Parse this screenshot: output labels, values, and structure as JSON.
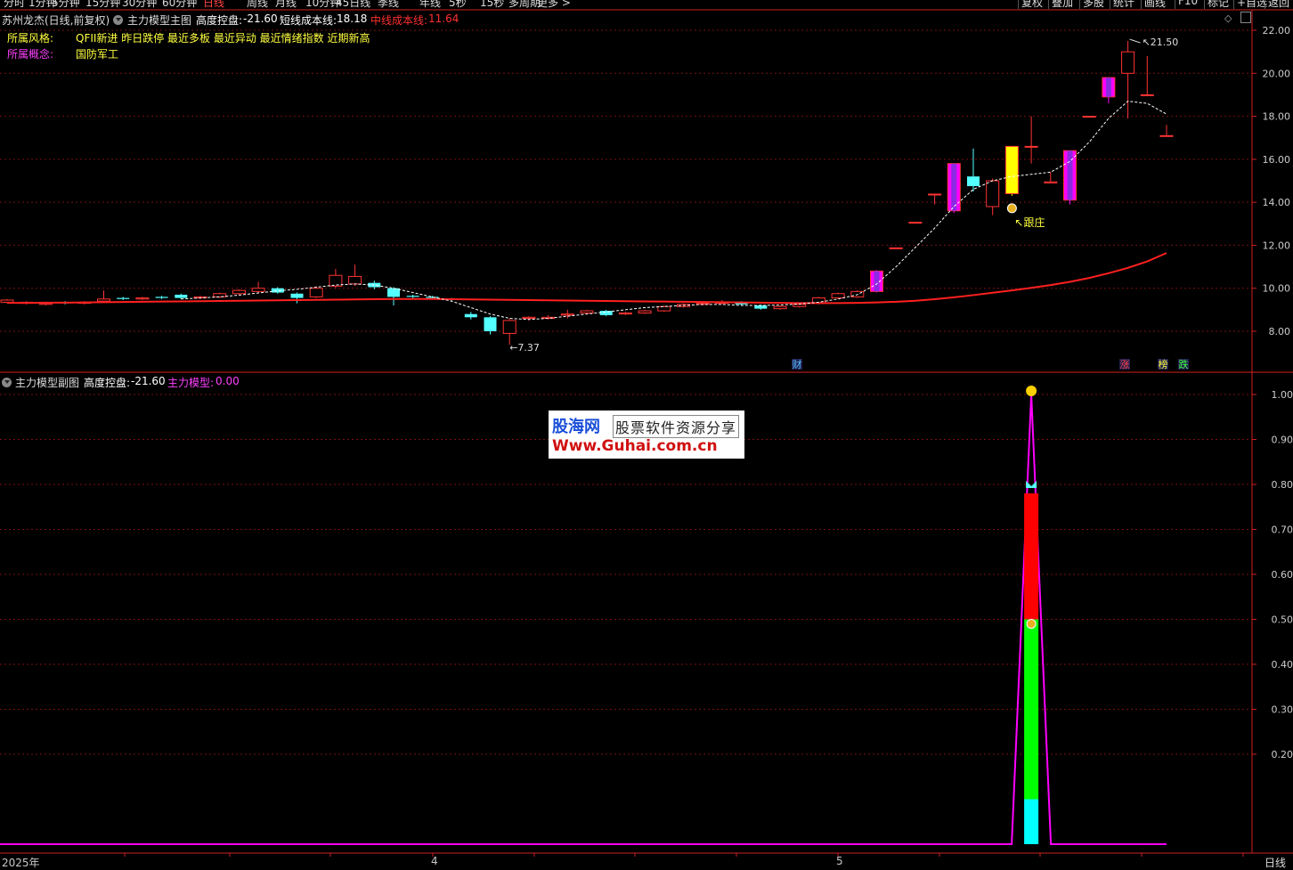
{
  "toolbar": {
    "periods": [
      "分时",
      "1分钟",
      "5分钟",
      "15分钟",
      "30分钟",
      "60分钟",
      "日线",
      "周线",
      "月线",
      "10分钟",
      "45日线",
      "季线",
      "年线",
      "5秒",
      "15秒",
      "多周期",
      "更多 >"
    ],
    "active_period": "日线",
    "right_buttons": [
      "复权",
      "叠加",
      "多股",
      "统计",
      "画线",
      "F10",
      "标记",
      "+自选",
      "返回"
    ]
  },
  "main_panel": {
    "stock_title": "苏州龙杰(日线,前复权)",
    "indicator_name": "主力模型主图",
    "high_control_label": "高度控盘:",
    "high_control_value": "-21.60",
    "short_cost_label": "短线成本线:",
    "short_cost_value": "18.18",
    "mid_cost_label": "中线成本线:",
    "mid_cost_value": "11.64",
    "style_label": "所属风格:",
    "style_value": "QFII新进 昨日跌停 最近多板 最近异动 最近情绪指数 近期新高",
    "concept_label": "所属概念:",
    "concept_value": "国防军工",
    "y_ticks": [
      "22.00",
      "20.00",
      "18.00",
      "16.00",
      "14.00",
      "12.00",
      "10.00",
      "8.00"
    ],
    "high_marker": "21.50",
    "low_marker": "7.37",
    "follow_marker": "跟庄",
    "event_badges": {
      "cai": "财",
      "zhang": "涨",
      "bang": "榜",
      "die": "跌"
    },
    "colors": {
      "up": "#ff3333",
      "down": "#54ffff",
      "mid_line": "#ff2020",
      "short_line": "#ffffff",
      "special_yellow": "#ffff00",
      "special_magenta": "#ff00ff"
    }
  },
  "sub_panel": {
    "indicator_name": "主力模型副图",
    "high_control_label": "高度控盘:",
    "high_control_value": "-21.60",
    "model_label": "主力模型:",
    "model_value": "0.00",
    "y_ticks": [
      "1.00",
      "0.90",
      "0.80",
      "0.70",
      "0.60",
      "0.50",
      "0.40",
      "0.30",
      "0.20"
    ]
  },
  "watermark": {
    "brand": "股海网",
    "slogan": "股票软件资源分享",
    "url": "Www.Guhai.com.cn"
  },
  "x_axis": {
    "labels": [
      "2025年",
      "4",
      "5"
    ],
    "period_tag": "日线"
  },
  "chart_data": {
    "type": "candlestick",
    "candles": [
      {
        "o": 9.35,
        "c": 9.45,
        "h": 9.5,
        "l": 9.3
      },
      {
        "o": 9.3,
        "c": 9.35,
        "h": 9.4,
        "l": 9.25
      },
      {
        "o": 9.25,
        "c": 9.3,
        "h": 9.35,
        "l": 9.2
      },
      {
        "o": 9.35,
        "c": 9.3,
        "h": 9.4,
        "l": 9.25
      },
      {
        "o": 9.3,
        "c": 9.35,
        "h": 9.4,
        "l": 9.25
      },
      {
        "o": 9.4,
        "c": 9.5,
        "h": 9.9,
        "l": 9.35
      },
      {
        "o": 9.55,
        "c": 9.5,
        "h": 9.6,
        "l": 9.45
      },
      {
        "o": 9.5,
        "c": 9.55,
        "h": 9.6,
        "l": 9.45
      },
      {
        "o": 9.6,
        "c": 9.55,
        "h": 9.65,
        "l": 9.5
      },
      {
        "o": 9.7,
        "c": 9.55,
        "h": 9.75,
        "l": 9.5
      },
      {
        "o": 9.55,
        "c": 9.6,
        "h": 9.65,
        "l": 9.5
      },
      {
        "o": 9.6,
        "c": 9.75,
        "h": 9.8,
        "l": 9.55
      },
      {
        "o": 9.75,
        "c": 9.9,
        "h": 9.95,
        "l": 9.7
      },
      {
        "o": 9.85,
        "c": 10.0,
        "h": 10.3,
        "l": 9.8
      },
      {
        "o": 10.0,
        "c": 9.8,
        "h": 10.05,
        "l": 9.75
      },
      {
        "o": 9.75,
        "c": 9.55,
        "h": 9.8,
        "l": 9.3
      },
      {
        "o": 9.6,
        "c": 10.0,
        "h": 10.1,
        "l": 9.55
      },
      {
        "o": 10.1,
        "c": 10.6,
        "h": 10.9,
        "l": 10.0
      },
      {
        "o": 10.2,
        "c": 10.55,
        "h": 11.1,
        "l": 10.1
      },
      {
        "o": 10.25,
        "c": 10.05,
        "h": 10.35,
        "l": 9.95
      },
      {
        "o": 10.0,
        "c": 9.6,
        "h": 10.05,
        "l": 9.2
      },
      {
        "o": 9.65,
        "c": 9.6,
        "h": 9.7,
        "l": 9.5
      },
      {
        "o": 9.6,
        "c": 9.55,
        "h": 9.65,
        "l": 9.5
      },
      {
        "o": 9.5,
        "c": 9.45,
        "h": 9.55,
        "l": 9.4
      },
      {
        "o": 8.8,
        "c": 8.65,
        "h": 8.9,
        "l": 8.55
      },
      {
        "o": 8.65,
        "c": 8.0,
        "h": 8.7,
        "l": 7.85
      },
      {
        "o": 7.9,
        "c": 8.5,
        "h": 8.6,
        "l": 7.37
      },
      {
        "o": 8.6,
        "c": 8.65,
        "h": 8.7,
        "l": 8.5
      },
      {
        "o": 8.6,
        "c": 8.65,
        "h": 8.75,
        "l": 8.55
      },
      {
        "o": 8.75,
        "c": 8.8,
        "h": 9.0,
        "l": 8.6
      },
      {
        "o": 8.85,
        "c": 8.95,
        "h": 9.0,
        "l": 8.8
      },
      {
        "o": 8.95,
        "c": 8.75,
        "h": 9.0,
        "l": 8.7
      },
      {
        "o": 8.8,
        "c": 8.85,
        "h": 8.9,
        "l": 8.75
      },
      {
        "o": 8.85,
        "c": 8.95,
        "h": 9.0,
        "l": 8.8
      },
      {
        "o": 8.95,
        "c": 9.15,
        "h": 9.2,
        "l": 8.9
      },
      {
        "o": 9.15,
        "c": 9.25,
        "h": 9.3,
        "l": 9.1
      },
      {
        "o": 9.25,
        "c": 9.3,
        "h": 9.4,
        "l": 9.2
      },
      {
        "o": 9.3,
        "c": 9.35,
        "h": 9.45,
        "l": 9.25
      },
      {
        "o": 9.35,
        "c": 9.25,
        "h": 9.4,
        "l": 9.2
      },
      {
        "o": 9.2,
        "c": 9.05,
        "h": 9.25,
        "l": 9.0
      },
      {
        "o": 9.05,
        "c": 9.15,
        "h": 9.2,
        "l": 9.0
      },
      {
        "o": 9.15,
        "c": 9.25,
        "h": 9.3,
        "l": 9.1
      },
      {
        "o": 9.3,
        "c": 9.55,
        "h": 9.6,
        "l": 9.25
      },
      {
        "o": 9.55,
        "c": 9.75,
        "h": 9.8,
        "l": 9.5
      },
      {
        "o": 9.6,
        "c": 9.85,
        "h": 9.9,
        "l": 9.55
      },
      {
        "o": 9.85,
        "c": 10.8,
        "h": 10.85,
        "l": 9.8,
        "color": "#ff00ff"
      },
      {
        "o": 11.88,
        "c": 11.88,
        "h": 11.88,
        "l": 11.88
      },
      {
        "o": 13.07,
        "c": 13.07,
        "h": 13.07,
        "l": 13.07
      },
      {
        "o": 14.38,
        "c": 14.38,
        "h": 14.38,
        "l": 13.9
      },
      {
        "o": 13.6,
        "c": 15.8,
        "h": 15.8,
        "l": 13.5,
        "color": "#ff00ff"
      },
      {
        "o": 15.2,
        "c": 14.75,
        "h": 16.5,
        "l": 14.5
      },
      {
        "o": 13.8,
        "c": 15.0,
        "h": 15.1,
        "l": 13.4
      },
      {
        "o": 14.4,
        "c": 16.6,
        "h": 16.6,
        "l": 14.3,
        "color": "#ffff00"
      },
      {
        "o": 16.6,
        "c": 16.6,
        "h": 18.0,
        "l": 15.8
      },
      {
        "o": 14.9,
        "c": 14.95,
        "h": 15.4,
        "l": 14.9
      },
      {
        "o": 14.1,
        "c": 16.4,
        "h": 16.4,
        "l": 13.9,
        "color": "#ff00ff"
      },
      {
        "o": 18.0,
        "c": 18.0,
        "h": 18.0,
        "l": 18.0
      },
      {
        "o": 18.9,
        "c": 19.8,
        "h": 19.8,
        "l": 18.6,
        "color": "#ff00ff"
      },
      {
        "o": 20.0,
        "c": 21.0,
        "h": 21.5,
        "l": 17.9
      },
      {
        "o": 19.0,
        "c": 19.0,
        "h": 20.8,
        "l": 19.0
      },
      {
        "o": 17.1,
        "c": 17.1,
        "h": 17.6,
        "l": 17.1
      }
    ],
    "mid_cost_line": [
      9.32,
      9.32,
      9.33,
      9.33,
      9.34,
      9.35,
      9.36,
      9.37,
      9.38,
      9.39,
      9.4,
      9.41,
      9.42,
      9.43,
      9.44,
      9.45,
      9.46,
      9.47,
      9.48,
      9.49,
      9.5,
      9.5,
      9.5,
      9.49,
      9.48,
      9.47,
      9.46,
      9.45,
      9.44,
      9.43,
      9.42,
      9.41,
      9.4,
      9.39,
      9.38,
      9.37,
      9.36,
      9.35,
      9.34,
      9.33,
      9.32,
      9.31,
      9.31,
      9.31,
      9.32,
      9.34,
      9.37,
      9.42,
      9.49,
      9.58,
      9.68,
      9.79,
      9.9,
      10.02,
      10.15,
      10.3,
      10.48,
      10.7,
      10.95,
      11.25,
      11.64
    ],
    "short_cost_line": [
      null,
      null,
      null,
      null,
      null,
      null,
      null,
      null,
      null,
      9.5,
      9.55,
      9.6,
      9.68,
      9.78,
      9.88,
      9.95,
      10.05,
      10.15,
      10.2,
      10.15,
      10.0,
      9.8,
      9.6,
      9.4,
      9.1,
      8.8,
      8.6,
      8.55,
      8.6,
      8.7,
      8.8,
      8.9,
      9.0,
      9.1,
      9.15,
      9.2,
      9.25,
      9.25,
      9.2,
      9.2,
      9.22,
      9.27,
      9.35,
      9.5,
      9.7,
      10.2,
      11.0,
      11.9,
      12.8,
      13.8,
      14.6,
      15.0,
      15.2,
      15.3,
      15.4,
      15.9,
      16.8,
      17.9,
      18.7,
      18.6,
      18.1
    ],
    "sub_model": {
      "peak_index": 53,
      "peak": 1.0,
      "segments": [
        {
          "from": 0,
          "to": 0.1,
          "color": "#00ffff"
        },
        {
          "from": 0.1,
          "to": 0.5,
          "color": "#00ff00"
        },
        {
          "from": 0.5,
          "to": 0.78,
          "color": "#ff0000"
        }
      ]
    }
  }
}
